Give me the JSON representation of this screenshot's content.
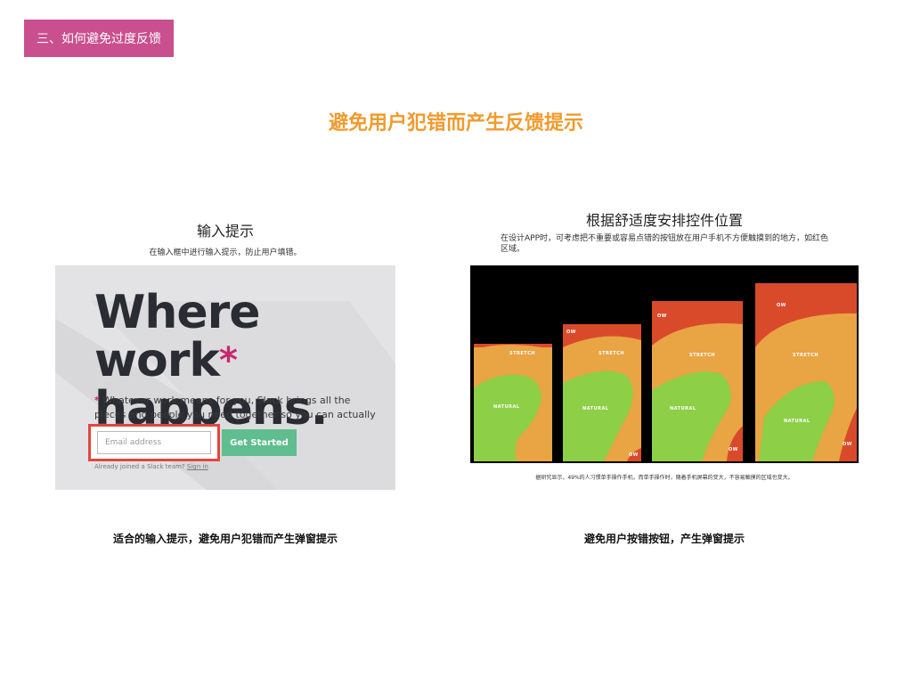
{
  "section_tag": "三、如何避免过度反馈",
  "main_title": "避免用户犯错而产生反馈提示",
  "left_panel": {
    "heading": "输入提示",
    "subtitle": "在输入框中进行输入提示，防止用户填错。",
    "screenshot": {
      "headline_line1": "Where work",
      "headline_star": "*",
      "headline_line2": "happens.",
      "body_star": "*",
      "body_text": " Whatever work means for you, Slack brings all the pieces and people you need together so you can actually get things done.",
      "email_placeholder": "Email address",
      "get_started_label": "Get Started",
      "already_text": "Already joined a Slack team?",
      "sign_in_label": "Sign in"
    },
    "caption": "适合的输入提示，避免用户犯错而产生弹窗提示"
  },
  "right_panel": {
    "heading": "根据舒适度安排控件位置",
    "subtitle": "在设计APP时，可考虑把不重要或容易点错的按钮放在用户手机不方便触摸到的地方，如红色区域。",
    "zone_labels": {
      "stretch": "STRETCH",
      "natural": "NATURAL",
      "ow": "OW"
    },
    "research_note": "据研究显示，49%的人习惯单手操作手机，而单手操作时，随着手机屏幕的变大，不容易触摸的区域也变大。",
    "caption": "避免用户按错按钮，产生弹窗提示"
  },
  "colors": {
    "tag_bg": "#c94f8e",
    "title": "#f19a2c",
    "zone_red": "#d94a2b",
    "zone_orange": "#e9a444",
    "zone_green": "#8dcf47",
    "highlight_box": "#e3463d",
    "button_green": "#5fbd8f"
  }
}
